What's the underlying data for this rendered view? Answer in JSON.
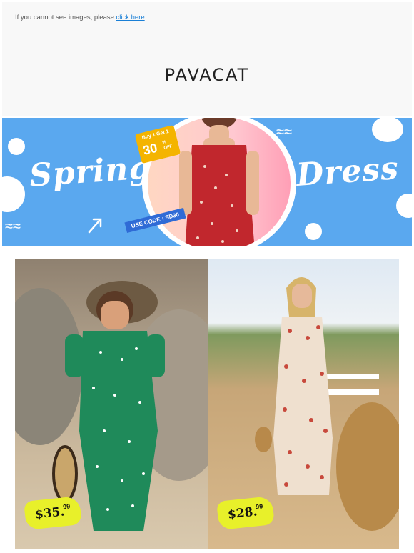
{
  "header": {
    "notice_text": "If you cannot see images, please ",
    "notice_link": "click here",
    "logo": "PAVACAT"
  },
  "banner": {
    "left_word": "Spring",
    "right_word": "Dress",
    "promo_top": "Buy 1 Get 1",
    "promo_percent": "30",
    "promo_unit": "%",
    "promo_off": "OFF",
    "code_label": "USE CODE : SD30",
    "colors": {
      "background": "#5aa8ef",
      "promo": "#f4b400",
      "code": "#2f6bd6"
    }
  },
  "products": [
    {
      "price": "$35.",
      "cents": "99",
      "dress_color": "#1f8a5a",
      "pattern": "white polka dots"
    },
    {
      "price": "$28.",
      "cents": "99",
      "dress_color": "#e9d6c2",
      "pattern": "red floral"
    }
  ],
  "icons": [
    "arrow-icon",
    "wave-icon"
  ]
}
